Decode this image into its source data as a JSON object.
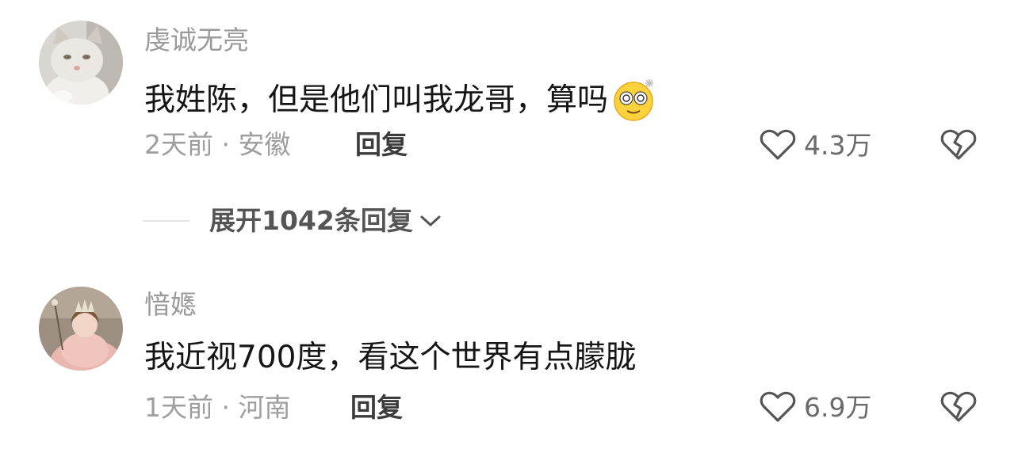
{
  "comments": [
    {
      "username": "虔诚无亮",
      "text": "我姓陈，但是他们叫我龙哥，算吗",
      "time": "2天前",
      "location": "安徽",
      "reply_label": "回复",
      "like_count": "4.3万",
      "avatar": "cat-avatar",
      "emoji": "dizzy-face-emoji"
    },
    {
      "username": "愔嫕",
      "text": "我近视700度，看这个世界有点朦胧",
      "time": "1天前",
      "location": "河南",
      "reply_label": "回复",
      "like_count": "6.9万",
      "avatar": "princess-avatar"
    }
  ],
  "expand_replies": {
    "label": "展开1042条回复"
  },
  "meta_separator": "·",
  "icons": {
    "like": "heart-outline-icon",
    "dislike": "broken-heart-icon",
    "expand": "chevron-down-icon"
  },
  "colors": {
    "username": "#9a9a9a",
    "text": "#161616",
    "meta": "#9e9e9e",
    "reply": "#3c3c3c",
    "icon": "#555555"
  }
}
